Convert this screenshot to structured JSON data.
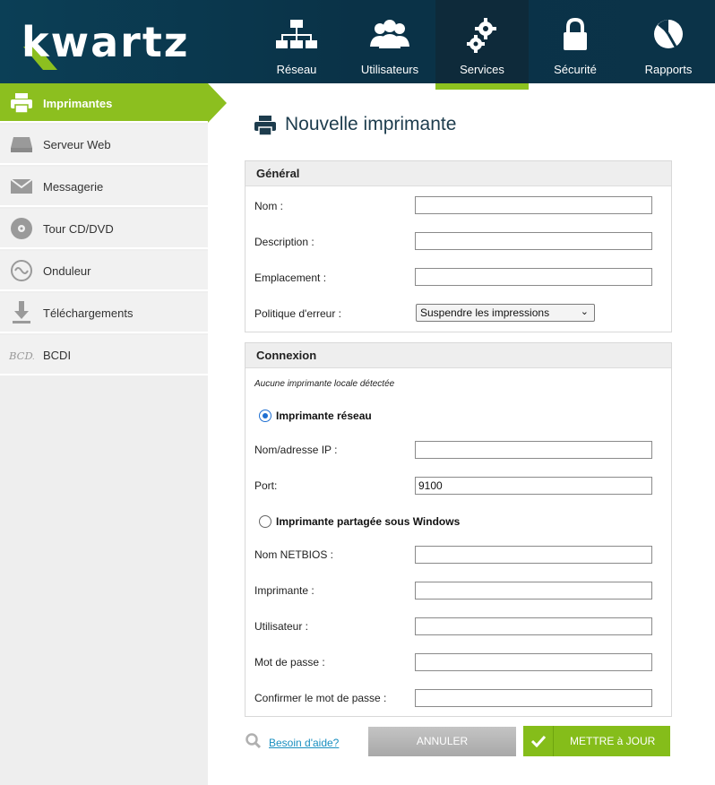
{
  "app": {
    "logo_text": "kwartz"
  },
  "nav": {
    "items": [
      {
        "label": "Réseau",
        "icon": "network-icon"
      },
      {
        "label": "Utilisateurs",
        "icon": "users-icon"
      },
      {
        "label": "Services",
        "icon": "gears-icon",
        "active": true
      },
      {
        "label": "Sécurité",
        "icon": "lock-icon"
      },
      {
        "label": "Rapports",
        "icon": "pie-chart-icon"
      }
    ]
  },
  "sidebar": {
    "items": [
      {
        "label": "Imprimantes",
        "icon": "printer-icon",
        "active": true
      },
      {
        "label": "Serveur Web",
        "icon": "server-icon"
      },
      {
        "label": "Messagerie",
        "icon": "envelope-icon"
      },
      {
        "label": "Tour CD/DVD",
        "icon": "disc-icon"
      },
      {
        "label": "Onduleur",
        "icon": "wave-icon"
      },
      {
        "label": "Téléchargements",
        "icon": "download-icon"
      },
      {
        "label": "BCDI",
        "icon": "bcdi-icon"
      }
    ]
  },
  "page": {
    "title": "Nouvelle imprimante"
  },
  "general": {
    "heading": "Général",
    "name_label": "Nom :",
    "name_value": "",
    "description_label": "Description :",
    "description_value": "",
    "location_label": "Emplacement :",
    "location_value": "",
    "error_policy_label": "Politique d'erreur :",
    "error_policy_value": "Suspendre les impressions"
  },
  "connection": {
    "heading": "Connexion",
    "note": "Aucune imprimante locale détectée",
    "network_radio_label": "Imprimante réseau",
    "network_selected": true,
    "ip_label": "Nom/adresse IP :",
    "ip_value": "",
    "port_label": "Port:",
    "port_value": "9100",
    "windows_radio_label": "Imprimante partagée sous Windows",
    "netbios_label": "Nom NETBIOS :",
    "netbios_value": "",
    "printer_label": "Imprimante :",
    "printer_value": "",
    "user_label": "Utilisateur :",
    "user_value": "",
    "password_label": "Mot de passe :",
    "password_value": "",
    "confirm_label": "Confirmer le mot de passe :",
    "confirm_value": ""
  },
  "actions": {
    "help_label": "Besoin d'aide?",
    "cancel_label": "ANNULER",
    "update_label": "METTRE à JOUR"
  },
  "colors": {
    "accent": "#8cbf1f",
    "header": "#0b3f56"
  }
}
